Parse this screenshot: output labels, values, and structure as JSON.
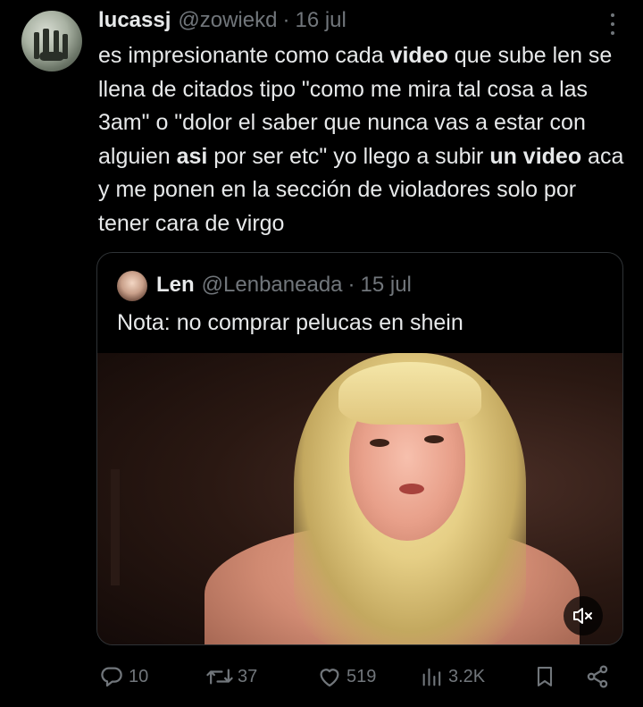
{
  "author": {
    "display_name": "lucassj",
    "handle": "@zowiekd",
    "separator": "·",
    "date": "16 jul"
  },
  "tweet": {
    "segments": [
      {
        "text": "es impresionante como cada ",
        "bold": false
      },
      {
        "text": "video",
        "bold": true
      },
      {
        "text": " que sube len se llena de citados tipo \"como me mira tal cosa a las 3am\" o \"dolor el saber que nunca vas a estar con alguien ",
        "bold": false
      },
      {
        "text": "asi",
        "bold": true
      },
      {
        "text": " por ser etc\" yo llego a subir ",
        "bold": false
      },
      {
        "text": "un video",
        "bold": true
      },
      {
        "text": " aca y me ponen en la sección de violadores solo por tener cara de virgo",
        "bold": false
      }
    ]
  },
  "quoted": {
    "display_name": "Len",
    "handle": "@Lenbaneada",
    "separator": "·",
    "date": "15 jul",
    "text": "Nota: no comprar pelucas en shein",
    "media_icon": "speaker-muted-icon"
  },
  "actions": {
    "replies": "10",
    "retweets": "37",
    "likes": "519",
    "views": "3.2K",
    "icons": [
      "reply-icon",
      "retweet-icon",
      "like-icon",
      "views-icon",
      "bookmark-icon",
      "share-icon"
    ]
  },
  "colors": {
    "background": "#000000",
    "text": "#e7e9ea",
    "muted": "#71767b",
    "border": "#2f3336"
  }
}
